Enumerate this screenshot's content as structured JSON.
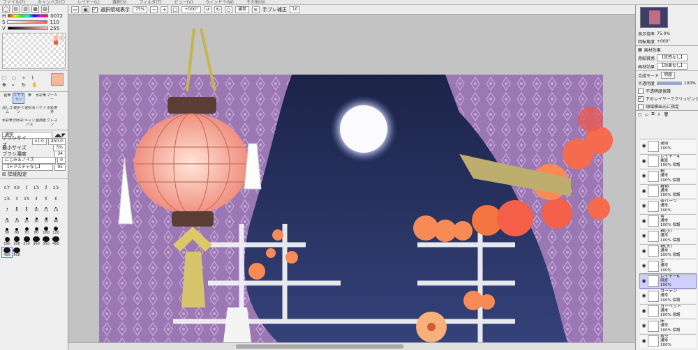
{
  "menubar": {
    "items": [
      "ファイル(F)",
      "キャンバス(C)",
      "レイヤー(L)",
      "選択(S)",
      "フィルタ(T)",
      "ビュー(V)",
      "ウィンドウ(W)",
      "その他(O)"
    ]
  },
  "toolbar": {
    "show_selection_label": "選択領域表示",
    "zoom": "75%",
    "rotation": "+000°",
    "blend": "通常",
    "stabilizer_label": "手ブレ補正",
    "stabilizer_value": "10"
  },
  "colors": {
    "selected": "#fdb79b",
    "sky": "#24305c",
    "curtain": "#9b78b4",
    "lantern": "#f3a89a",
    "cloud": "#f56b4e"
  },
  "color_panel": {
    "h_label": "H",
    "h_value": "0072",
    "s_label": "S",
    "s_value": "110",
    "v_label": "V",
    "v_value": "255"
  },
  "tools": {
    "row1": [
      "鉛筆",
      "エアブラシ",
      "筆",
      "水彩筆",
      "マーカー"
    ],
    "row2": [
      "消しゴム",
      "選択ペン",
      "選択消",
      "バケツ",
      "水彩境界"
    ],
    "row3": [
      "水彩筆",
      "旧水彩",
      "キャンバス",
      "画用紙",
      "クレヨン"
    ]
  },
  "brush": {
    "blend_mode": "通常",
    "size_label": "ブラシサイズ",
    "size_mult": "x1.0",
    "size_value": "450.0",
    "min_label": "最小サイズ",
    "min_value": "5%",
    "density_label": "ブラシ濃度",
    "density_value": "34",
    "blur_label": "にじみ＆ノイズ",
    "blur_value": "0",
    "texture_label": "【テクスチャなし】",
    "texture_value": "95",
    "detail_label": "詳細設定"
  },
  "dots": [
    "0.7",
    "0.8",
    "1",
    "1.5",
    "2",
    "2.3",
    "2.6",
    "3",
    "3.5",
    "4",
    "5",
    "6",
    "7",
    "8",
    "9",
    "10",
    "12",
    "14",
    "16",
    "20",
    "25",
    "30",
    "35",
    "40",
    "50",
    "60",
    "70",
    "80",
    "100",
    "120",
    "160",
    "200",
    "250",
    "300",
    "350",
    "400",
    "450",
    "500"
  ],
  "navigator": {
    "zoom_label": "表示倍率",
    "zoom_value": "75.0%",
    "rot_label": "回転角度",
    "rot_value": "+000°"
  },
  "layer_panel": {
    "paper_title": "画材効果",
    "paper_label": "用紙質感",
    "paper_value": "【質感なし】",
    "effect_label": "画材効果",
    "effect_value": "【効果なし】",
    "blend_label": "合成モード",
    "blend_value": "明度",
    "opacity_label": "不透明度",
    "opacity_value": "100%",
    "protect": "不透明度保護",
    "clip": "下のレイヤーでクリッピング",
    "select_src": "領域検出元に指定"
  },
  "layers": [
    {
      "name": "通常",
      "mode": "100%",
      "extra": ""
    },
    {
      "name": "レイヤー4",
      "mode": "乗算",
      "extra": "100% 保護"
    },
    {
      "name": "桐",
      "mode": "通常",
      "extra": "100% 保護"
    },
    {
      "name": "着物",
      "mode": "通常",
      "extra": "100% 保護"
    },
    {
      "name": "帯パーツ",
      "mode": "通常",
      "extra": "100%"
    },
    {
      "name": "帯",
      "mode": "通常",
      "extra": "100% 保護"
    },
    {
      "name": "袖(小)",
      "mode": "通常",
      "extra": "100% 保護"
    },
    {
      "name": "袖(大)",
      "mode": "通常",
      "extra": "100% 保護"
    },
    {
      "name": "手",
      "mode": "通常",
      "extra": "100%"
    },
    {
      "name": "レイヤー6",
      "mode": "明度",
      "extra": "100%"
    },
    {
      "name": "カーテン",
      "mode": "通常",
      "extra": "100% 保護"
    },
    {
      "name": "カーペット",
      "mode": "通常",
      "extra": "100% 保護"
    },
    {
      "name": "床",
      "mode": "通常",
      "extra": "100% 保護"
    },
    {
      "name": "夜空",
      "mode": "通常",
      "extra": "100%"
    }
  ]
}
